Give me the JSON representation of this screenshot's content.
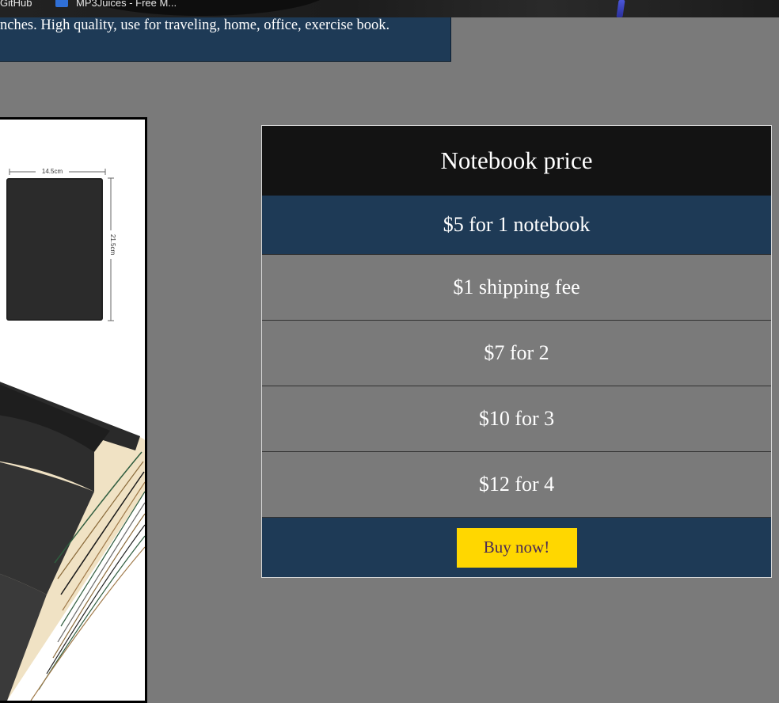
{
  "bookmarks_bar": {
    "items": [
      {
        "label": "GitHub",
        "icon": "github-icon"
      },
      {
        "label": "MP3Juices - Free M...",
        "icon": "bookmark-app-icon"
      }
    ]
  },
  "description": {
    "text": "nches. High quality, use for traveling, home, office, exercise book."
  },
  "product_image": {
    "alt": "Notebook product photo",
    "width_label": "14.5cm",
    "height_label": "21.5cm"
  },
  "pricing": {
    "title": "Notebook price",
    "rows": [
      "$5 for 1 notebook",
      "$1 shipping fee",
      "$7 for 2",
      "$10 for 3",
      "$12 for 4"
    ],
    "buy_label": "Buy now!"
  },
  "colors": {
    "page_bg": "#7a7a7a",
    "navy": "#1e3a56",
    "header_bg": "#131313",
    "button_bg": "#ffd700",
    "button_text": "#4a2a55"
  }
}
